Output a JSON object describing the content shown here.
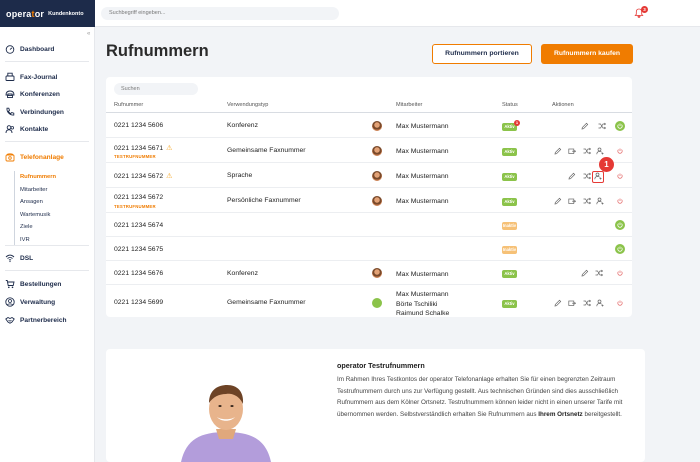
{
  "brand": {
    "logo": "opera",
    "logo_accent": "t",
    "logo_end": "or",
    "subtitle": "Kundenkonto"
  },
  "search": {
    "placeholder": "Suchbegriff eingeben..."
  },
  "notifications": {
    "count": "3"
  },
  "sidebar": {
    "collapse": "«",
    "items": [
      {
        "label": "Dashboard",
        "icon": "dashboard-icon"
      },
      {
        "label": "Fax-Journal",
        "icon": "fax-icon"
      },
      {
        "label": "Konferenzen",
        "icon": "conference-icon"
      },
      {
        "label": "Verbindungen",
        "icon": "phone-icon"
      },
      {
        "label": "Kontakte",
        "icon": "contacts-icon"
      },
      {
        "label": "Telefonanlage",
        "icon": "phone-system-icon"
      },
      {
        "label": "DSL",
        "icon": "wifi-icon"
      },
      {
        "label": "Bestellungen",
        "icon": "cart-icon"
      },
      {
        "label": "Verwaltung",
        "icon": "user-icon"
      },
      {
        "label": "Partnerbereich",
        "icon": "handshake-icon"
      }
    ],
    "subitems": [
      "Rufnummern",
      "Mitarbeiter",
      "Ansagen",
      "Wartemusik",
      "Ziele",
      "IVR"
    ]
  },
  "page": {
    "title": "Rufnummern",
    "port_button": "Rufnummern portieren",
    "buy_button": "Rufnummern kaufen"
  },
  "table": {
    "search_placeholder": "Suchen",
    "headers": {
      "number": "Rufnummer",
      "type": "Verwendungstyp",
      "employee": "Mitarbeiter",
      "status": "Status",
      "actions": "Aktionen"
    },
    "rows": [
      {
        "number": "0221 1234 5606",
        "type": "Konferenz",
        "employee": "Max Mustermann",
        "status": "Aktiv",
        "badge": "1"
      },
      {
        "number": "0221 1234 5671",
        "tag": "TESTRUFNUMMER",
        "type": "Gemeinsame Faxnummer",
        "employee": "Max Mustermann",
        "status": "Aktiv"
      },
      {
        "number": "0221 1234 5672",
        "type": "Sprache",
        "employee": "Max Mustermann",
        "status": "Aktiv"
      },
      {
        "number": "0221 1234 5672",
        "tag": "TESTRUFNUMMER",
        "type": "Persönliche Faxnummer",
        "employee": "Max Mustermann",
        "status": "Aktiv"
      },
      {
        "number": "0221 1234 5674",
        "status": "Inaktiv"
      },
      {
        "number": "0221 1234 5675",
        "status": "Inaktiv"
      },
      {
        "number": "0221 1234 5676",
        "type": "Konferenz",
        "employee": "Max Mustermann",
        "status": "Aktiv"
      },
      {
        "number": "0221 1234 5699",
        "type": "Gemeinsame Faxnummer",
        "employees": [
          "Max Mustermann",
          "Börte Tschiliki",
          "Raimund Schalke"
        ],
        "status": "Aktiv"
      }
    ]
  },
  "marker": {
    "label": "1"
  },
  "info": {
    "title": "operator Testrufnummern",
    "text_1": "Im Rahmen Ihres Testkontos der operator Telefonanlage erhalten Sie für einen begrenzten Zeitraum Testrufnummern durch uns zur Verfügung gestellt. Aus technischen Gründen sind dies ausschließlich Rufnummern aus dem Kölner Ortsnetz. Testrufnummern können leider nicht in einen unserer Tarife mit übernommen werden. Selbstverständlich erhalten Sie Rufnummern aus ",
    "text_bold": "Ihrem Ortsnetz",
    "text_2": " bereitgestellt."
  },
  "colors": {
    "accent": "#f07c00",
    "navy": "#1d2b4a",
    "active": "#8bc34a",
    "inactive": "#f6c177",
    "alert": "#e53935"
  }
}
